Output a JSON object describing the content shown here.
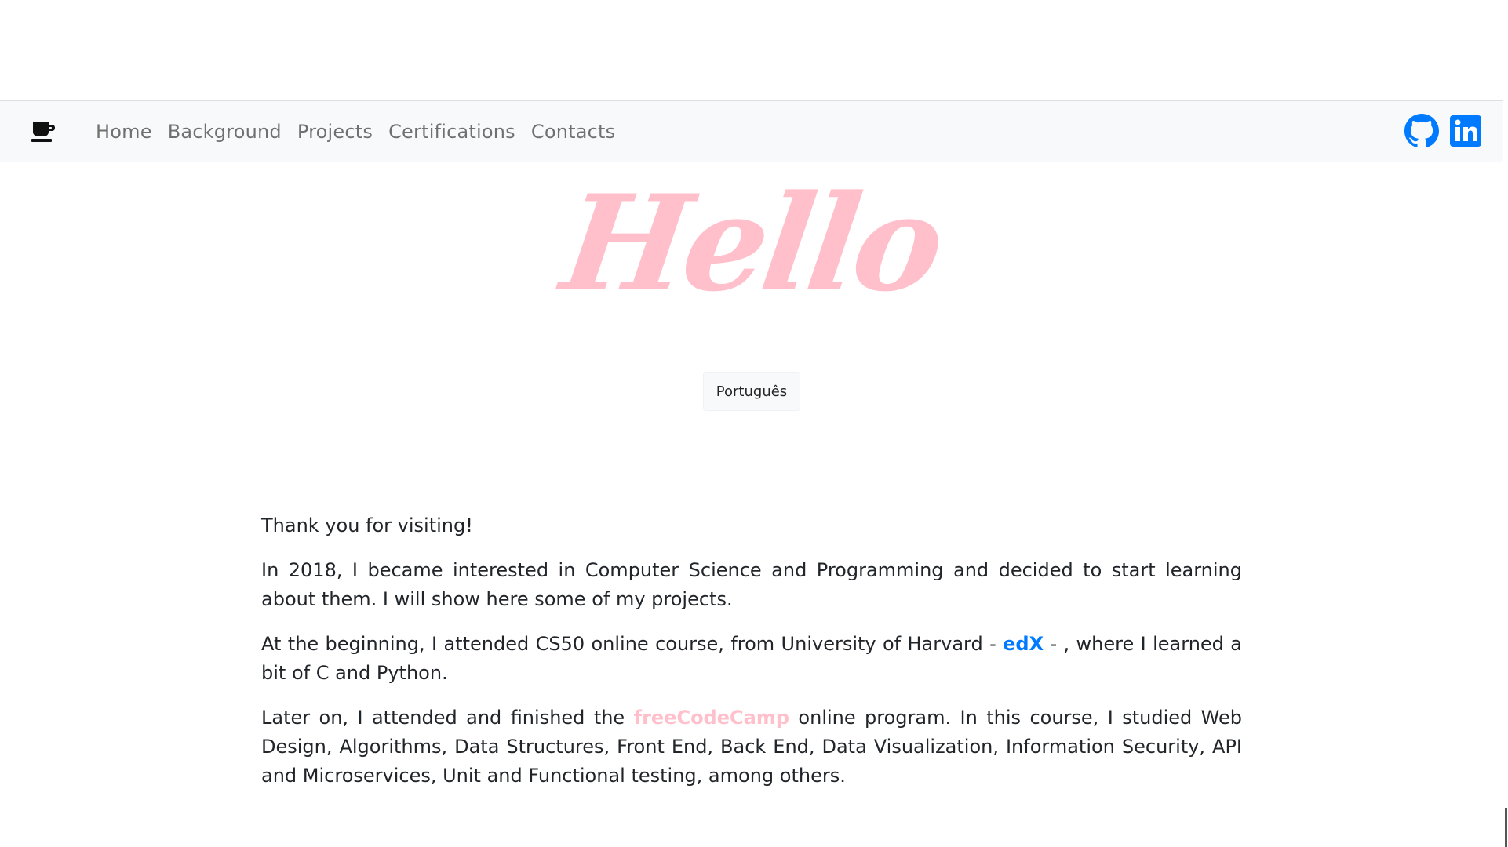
{
  "nav": {
    "brand_icon": "coffee-cup-icon",
    "links": [
      "Home",
      "Background",
      "Projects",
      "Certifications",
      "Contacts"
    ],
    "social": [
      {
        "name": "GitHub",
        "icon": "github-icon",
        "color": "#007bff"
      },
      {
        "name": "LinkedIn",
        "icon": "linkedin-icon",
        "color": "#007bff"
      }
    ]
  },
  "hero": {
    "title": "Hello",
    "title_color": "#ffc0cb",
    "language_button": "Português"
  },
  "content": {
    "p1": "Thank you for visiting!",
    "p2": "In 2018, I became interested in Computer Science and Programming and decided to start learning about them. I will show here some of my projects.",
    "p3_before": "At the beginning, I attended CS50 online course, from University of Harvard - ",
    "p3_link": "edX",
    "p3_after": " - , where I learned a bit of C and Python.",
    "p4_before": "Later on, I attended and finished the ",
    "p4_link": "freeCodeCamp",
    "p4_after": " online program. In this course, I studied Web Design, Algorithms, Data Structures, Front End, Back End, Data Visualization, Information Security, API and Microservices, Unit and Functional testing, among others."
  },
  "colors": {
    "navbar_bg": "#f8f9fa",
    "link_blue": "#007bff",
    "accent_pink": "#ffc0cb"
  }
}
